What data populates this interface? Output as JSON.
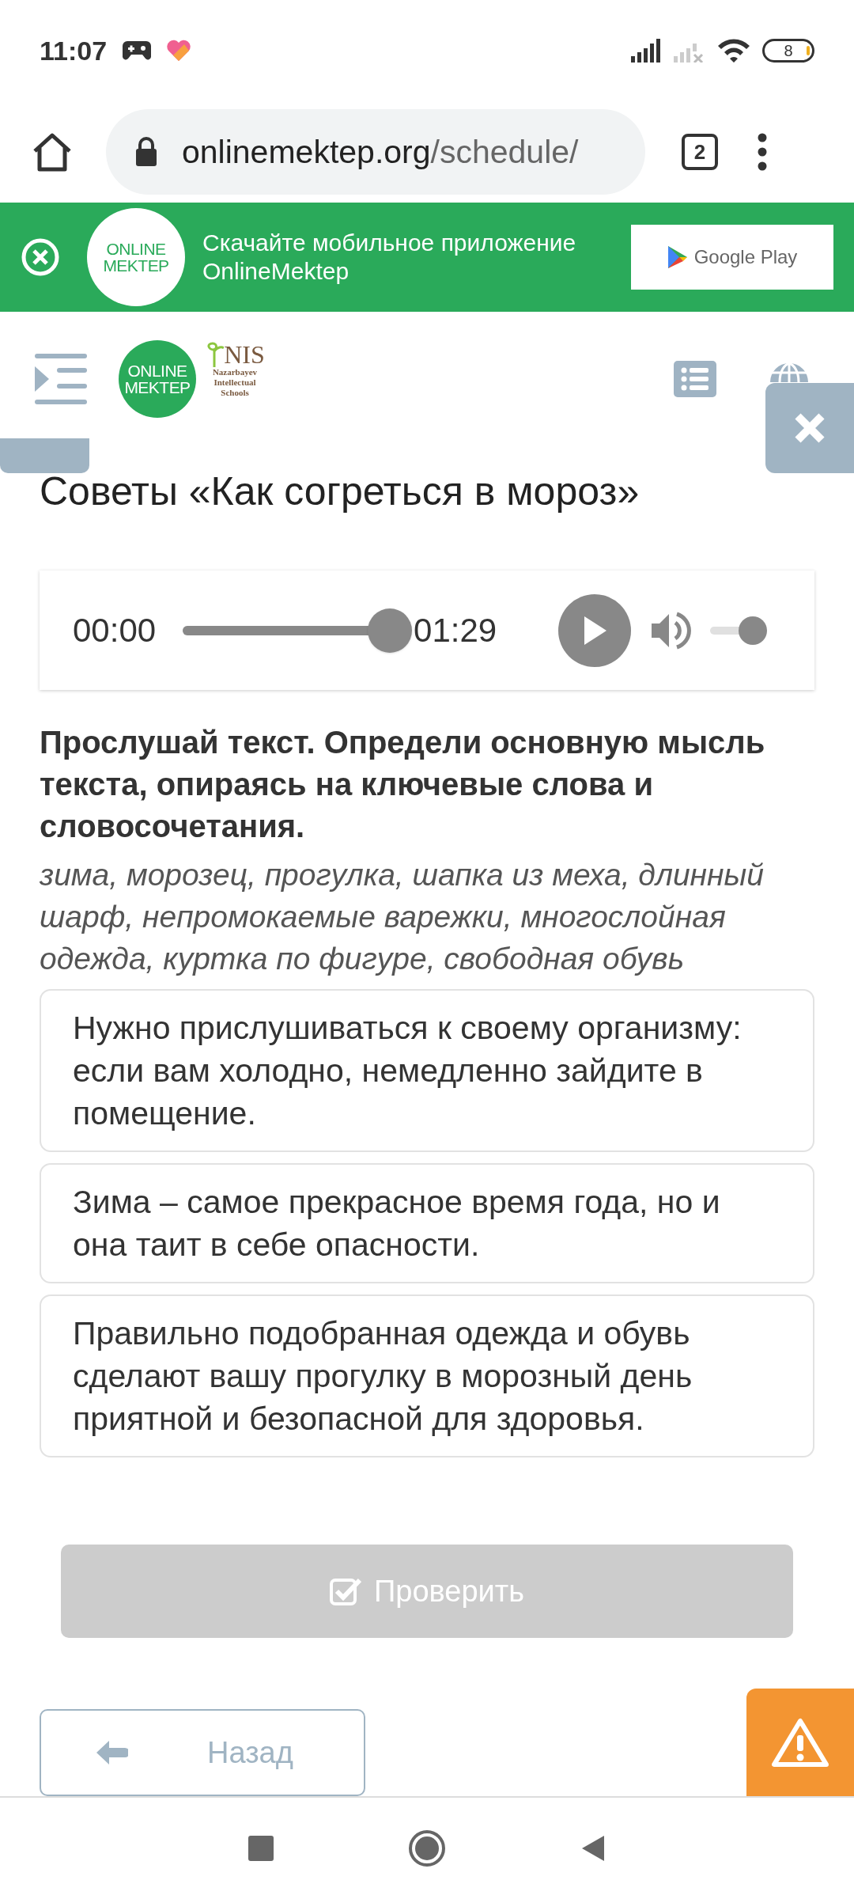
{
  "status_bar": {
    "time": "11:07",
    "battery": "8"
  },
  "browser": {
    "url_host": "onlinemektep.org",
    "url_path": "/schedule/",
    "tab_count": "2"
  },
  "banner": {
    "logo_line_1": "ONLINE",
    "logo_line_2": "MEKTEP",
    "text": "Скачайте мобильное приложение OnlineMektep",
    "store_button": "Google Play"
  },
  "header": {
    "logo_line_1": "ONLINE",
    "logo_line_2": "MEKTEP",
    "nis_title": "NIS",
    "nis_lines": [
      "Nazarbayev",
      "Intellectual",
      "Schools"
    ]
  },
  "title": "Советы «Как согреться в мороз»",
  "player": {
    "current": "00:00",
    "duration": "01:29",
    "progress": {
      "level": 1
    },
    "volume": {
      "level": 1
    }
  },
  "task": {
    "instruction": "Прослушай текст. Определи основную мысль текста, опираясь на ключевые слова и словосочетания.",
    "keywords": "зима, морозец, прогулка, шапка из меха, длинный шарф, непромокаемые варежки, многослойная одежда, куртка по фигуре, свободная обувь"
  },
  "options": [
    {
      "text": "Нужно прислушиваться к своему организму: если вам холодно, немедленно зайдите в помещение.",
      "selected": false
    },
    {
      "text": "Зима – самое прекрасное время года, но и она таит в себе опасности.",
      "selected": false
    },
    {
      "text": "Правильно подобранная одежда и обувь сделают вашу прогулку в морозный день приятной и безопасной для здоровья.",
      "selected": false
    }
  ],
  "check_button": {
    "label": "Проверить",
    "disabled": true
  },
  "back_button": {
    "label": "Назад"
  }
}
